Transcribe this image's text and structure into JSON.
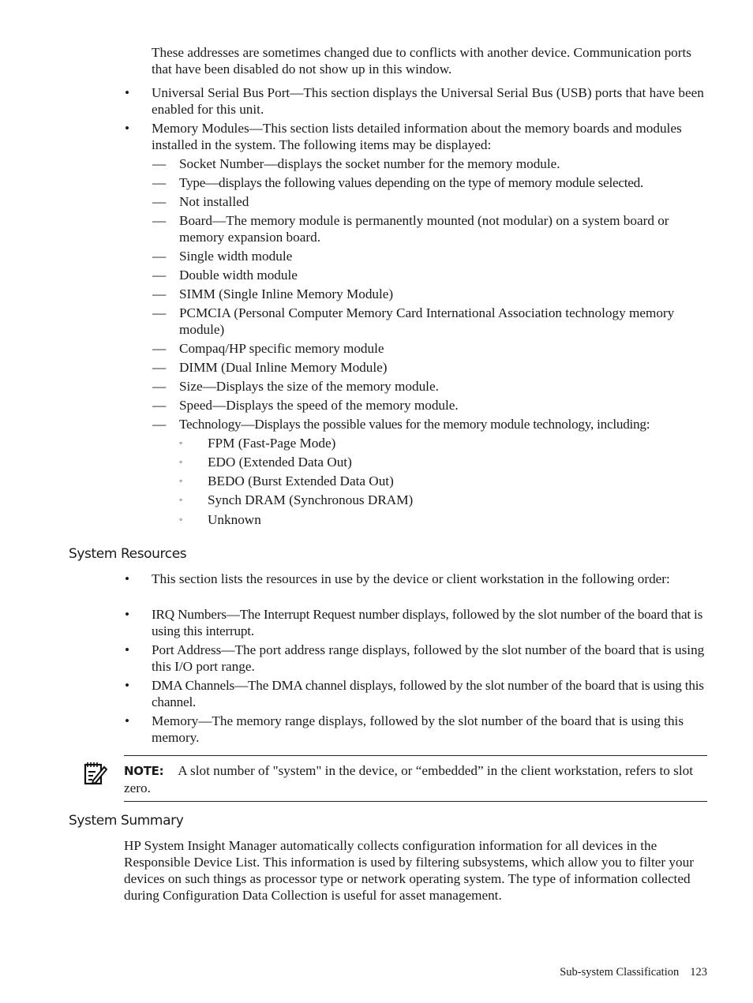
{
  "intro_paragraph": "These addresses are sometimes changed due to conflicts with another device. Communication ports that have been disabled do not show up in this window.",
  "bullets_top": [
    {
      "mark": "•",
      "text": "Universal Serial Bus Port—This section displays the Universal Serial Bus (USB) ports that have been enabled for this unit."
    },
    {
      "mark": "•",
      "text": "Memory Modules—This section lists detailed information about the memory boards and modules installed in the system. The following items may be displayed:"
    }
  ],
  "memory_items": [
    {
      "mark": "—",
      "text": "Socket Number—displays the socket number for the memory module."
    },
    {
      "mark": "—",
      "text": "Type—displays the following values depending on the type of memory module selected."
    },
    {
      "mark": "—",
      "text": "Not installed"
    },
    {
      "mark": "—",
      "text": "Board—The memory module is permanently mounted (not modular) on a system board or memory expansion board."
    },
    {
      "mark": "—",
      "text": "Single width module"
    },
    {
      "mark": "—",
      "text": "Double width module"
    },
    {
      "mark": "—",
      "text": "SIMM (Single Inline Memory Module)"
    },
    {
      "mark": "—",
      "text": "PCMCIA (Personal Computer Memory Card International Association technology memory module)"
    },
    {
      "mark": "—",
      "text": "Compaq/HP specific memory module"
    },
    {
      "mark": "—",
      "text": "DIMM (Dual Inline Memory Module)"
    },
    {
      "mark": "—",
      "text": "Size—Displays the size of the memory module."
    },
    {
      "mark": "—",
      "text": "Speed—Displays the speed of the memory module."
    },
    {
      "mark": "—",
      "text": "Technology—Displays the possible values for the memory module technology, including:"
    }
  ],
  "technology_items": [
    {
      "mark": "◦",
      "text": "FPM (Fast-Page Mode)"
    },
    {
      "mark": "◦",
      "text": "EDO (Extended Data Out)"
    },
    {
      "mark": "◦",
      "text": "BEDO (Burst Extended Data Out)"
    },
    {
      "mark": "◦",
      "text": "Synch DRAM (Synchronous DRAM)"
    },
    {
      "mark": "◦",
      "text": "Unknown"
    }
  ],
  "system_resources": {
    "heading": "System Resources",
    "bullets": [
      {
        "mark": "•",
        "text": "This section lists the resources in use by the device or client workstation in the following order:"
      },
      {
        "mark": "•",
        "text": "IRQ Numbers—The Interrupt Request number displays, followed by the slot number of the board that is using this interrupt."
      },
      {
        "mark": "•",
        "text": "Port Address—The port address range displays, followed by the slot number of the board that is using this I/O port range."
      },
      {
        "mark": "•",
        "text": "DMA Channels—The DMA channel displays, followed by the slot number of the board that is using this channel."
      },
      {
        "mark": "•",
        "text": "Memory—The memory range displays, followed by the slot number of the board that is using this memory."
      }
    ]
  },
  "note": {
    "icon": "note-pencil-icon",
    "label": "NOTE:",
    "text": "A slot number of \"system\" in the device, or “embedded” in the client workstation, refers to slot zero."
  },
  "system_summary": {
    "heading": "System Summary",
    "text": "HP System Insight Manager automatically collects configuration information for all devices in the Responsible Device List. This information is used by filtering subsystems, which allow you to filter your devices on such things as processor type or network operating system. The type of information collected during Configuration Data Collection is useful for asset management."
  },
  "footer": {
    "section": "Sub-system Classification",
    "page_number": "123"
  }
}
